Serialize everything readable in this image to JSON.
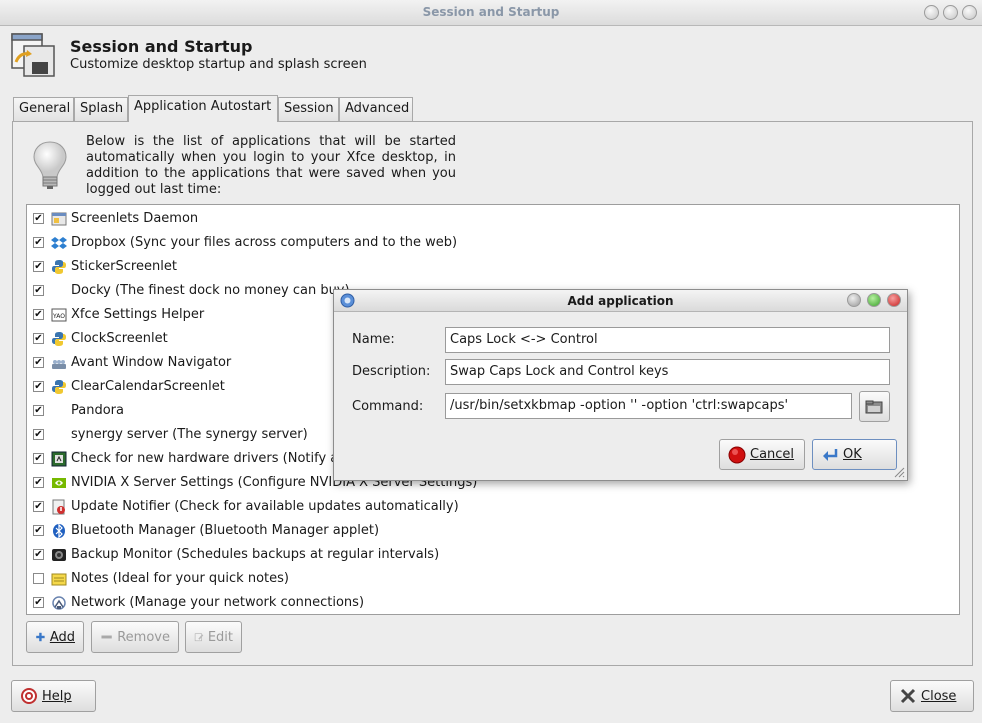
{
  "window": {
    "title": "Session and Startup",
    "header_title": "Session and Startup",
    "header_subtitle": "Customize desktop startup and splash screen"
  },
  "tabs": [
    {
      "label": "General"
    },
    {
      "label": "Splash"
    },
    {
      "label": "Application Autostart"
    },
    {
      "label": "Session"
    },
    {
      "label": "Advanced"
    }
  ],
  "intro_text": "Below is the list of applications that will be started automatically when you login to your Xfce desktop, in addition to the applications that were saved when you logged out last time:",
  "apps": [
    {
      "label": "Screenlets Daemon",
      "checked": true,
      "icon": "screenlets-icon"
    },
    {
      "label": "Dropbox (Sync your files across computers and to the web)",
      "checked": true,
      "icon": "dropbox-icon"
    },
    {
      "label": "StickerScreenlet",
      "checked": true,
      "icon": "python-icon"
    },
    {
      "label": "Docky (The finest dock no money can buy)",
      "checked": true,
      "icon": ""
    },
    {
      "label": "Xfce Settings Helper",
      "checked": true,
      "icon": "xfce-icon"
    },
    {
      "label": "ClockScreenlet",
      "checked": true,
      "icon": "python-icon"
    },
    {
      "label": "Avant Window Navigator",
      "checked": true,
      "icon": "awn-icon"
    },
    {
      "label": "ClearCalendarScreenlet",
      "checked": true,
      "icon": "python-icon"
    },
    {
      "label": "Pandora",
      "checked": true,
      "icon": ""
    },
    {
      "label": "synergy server (The synergy server)",
      "checked": true,
      "icon": ""
    },
    {
      "label": "Check for new hardware drivers (Notify about new hardware drivers available for the system)",
      "checked": true,
      "icon": "hardware-icon"
    },
    {
      "label": "NVIDIA X Server Settings (Configure NVIDIA X Server Settings)",
      "checked": true,
      "icon": "nvidia-icon"
    },
    {
      "label": "Update Notifier (Check for available updates automatically)",
      "checked": true,
      "icon": "update-icon"
    },
    {
      "label": "Bluetooth Manager (Bluetooth Manager applet)",
      "checked": true,
      "icon": "bluetooth-icon"
    },
    {
      "label": "Backup Monitor (Schedules backups at regular intervals)",
      "checked": true,
      "icon": "backup-icon"
    },
    {
      "label": "Notes (Ideal for your quick notes)",
      "checked": false,
      "icon": "notes-icon"
    },
    {
      "label": "Network (Manage your network connections)",
      "checked": true,
      "icon": "network-icon"
    }
  ],
  "buttons": {
    "add": "Add",
    "remove": "Remove",
    "edit": "Edit",
    "help": "Help",
    "close": "Close"
  },
  "dialog": {
    "title": "Add application",
    "name_label": "Name:",
    "name_value": "Caps Lock <-> Control",
    "description_label": "Description:",
    "description_value": "Swap Caps Lock and Control keys",
    "command_label": "Command:",
    "command_value": "/usr/bin/setxkbmap -option '' -option 'ctrl:swapcaps'",
    "cancel": "Cancel",
    "ok": "OK"
  },
  "colors": {
    "accent_blue": "#3a78c8",
    "title_text": "#8a97a8",
    "cancel_red": "#d01010"
  }
}
